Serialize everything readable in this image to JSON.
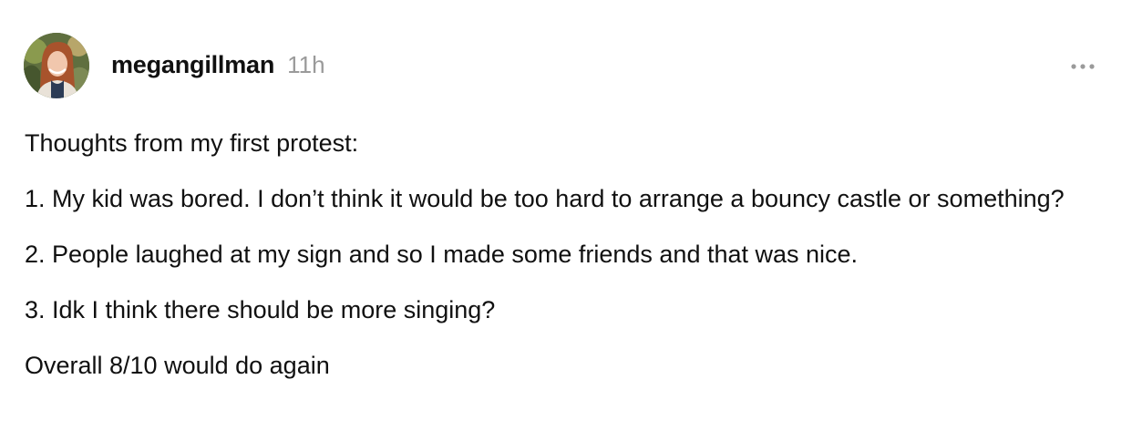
{
  "post": {
    "author": {
      "username": "megangillman",
      "avatar_icon": "profile-photo"
    },
    "timestamp": "11h",
    "more_icon": "more-horizontal-icon",
    "paragraphs": [
      "Thoughts from my first protest:",
      "1. My kid was bored. I don’t think it would be too hard to arrange a bouncy castle or something?",
      "2. People laughed at my sign and so I made some friends and that was nice.",
      "3. Idk I think there should be more singing?",
      "Overall 8/10 would do again"
    ]
  },
  "colors": {
    "text": "#101010",
    "muted": "#9a9a9a",
    "background": "#ffffff"
  }
}
